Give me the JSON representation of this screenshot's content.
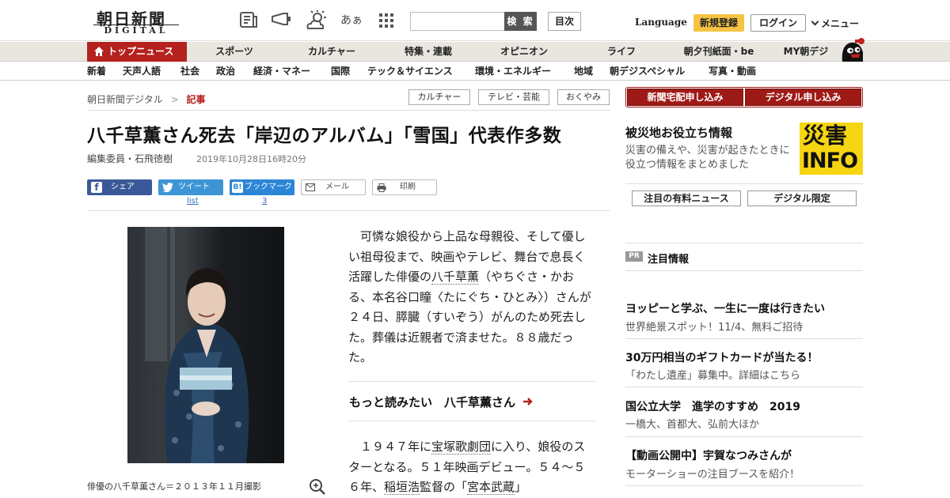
{
  "header": {
    "logo_main": "朝日新聞",
    "logo_sub": "DIGITAL",
    "hiragana_icon": "あぁ",
    "search_button": "検 索",
    "index_button": "目次",
    "language": "Language",
    "register": "新規登録",
    "login": "ログイン",
    "menu": "メニュー"
  },
  "nav_primary": [
    "トップニュース",
    "スポーツ",
    "カルチャー",
    "特集・連載",
    "オピニオン",
    "ライフ",
    "朝夕刊紙面・be",
    "MY朝デジ"
  ],
  "nav_secondary": [
    "新着",
    "天声人語",
    "社会",
    "政治",
    "経済・マネー",
    "国際",
    "テック＆サイエンス",
    "環境・エネルギー",
    "地域",
    "朝デジスペシャル",
    "写真・動画"
  ],
  "breadcrumb": {
    "home": "朝日新聞デジタル",
    "sep": ">",
    "current": "記事"
  },
  "tags": [
    "カルチャー",
    "テレビ・芸能",
    "おくやみ"
  ],
  "subscribe": {
    "newspaper": "新聞宅配申し込み",
    "digital": "デジタル申し込み"
  },
  "article": {
    "title": "八千草薫さん死去「岸辺のアルバム」「雪国」代表作多数",
    "author": "編集委員・石飛徳樹",
    "date": "2019年10月28日16時20分",
    "photo_caption": "俳優の八千草薫さん＝２０１３年１１月撮影",
    "para1_a": "　可憐な娘役から上品な母親役、そして優しい祖母役まで、映画やテレビ、舞台で息長く活躍した俳優の",
    "para1_link": "八千草薫",
    "para1_b": "（やちぐさ・かおる、本名谷口瞳〈たにぐち・ひとみ〉）さんが２４日、膵臓（すいぞう）がんのため死去した。葬儀は近親者で済ませた。８８歳だった。",
    "more_label": "もっと読みたい　八千草薫さん",
    "para2_a": "　１９４７年に",
    "para2_link1": "宝塚歌劇団",
    "para2_b": "に入り、娘役のスターとなる。５１年映画デビュー。５４～５６年、",
    "para2_link2": "稲垣浩",
    "para2_c": "監督の「",
    "para2_link3": "宮本武蔵",
    "para2_d": "」"
  },
  "share": {
    "facebook": "シェア",
    "twitter": "ツイート",
    "twitter_count": "list",
    "hatena": "ブックマーク",
    "hatena_count": "3",
    "mail": "メール",
    "print": "印刷"
  },
  "sidebar": {
    "disaster_title": "被災地お役立ち情報",
    "disaster_desc": "災害の備えや、災害が起きたときに役立つ情報をまとめました",
    "info_top": "災害",
    "info_bottom": "INFO",
    "paid_news": "注目の有料ニュース",
    "digital_only": "デジタル限定",
    "pr_badge": "PR",
    "pr_heading": "注目情報",
    "items": [
      {
        "title": "ヨッピーと学ぶ、一生に一度は行きたい",
        "sub": "世界絶景スポット！11/4、無料ご招待"
      },
      {
        "title": "30万円相当のギフトカードが当たる！",
        "sub": "「わたし遺産」募集中。詳細はこちら"
      },
      {
        "title": "国公立大学　進学のすすめ　2019",
        "sub": "一橋大、首都大、弘前大ほか"
      },
      {
        "title": "【動画公開中】宇賀なつみさんが",
        "sub": "モーターショーの注目ブースを紹介！"
      }
    ]
  },
  "colors": {
    "brand_red": "#b5211d",
    "accent_yellow": "#f6c442",
    "info_yellow": "#f6d512",
    "link_blue": "#3a6fb5"
  }
}
